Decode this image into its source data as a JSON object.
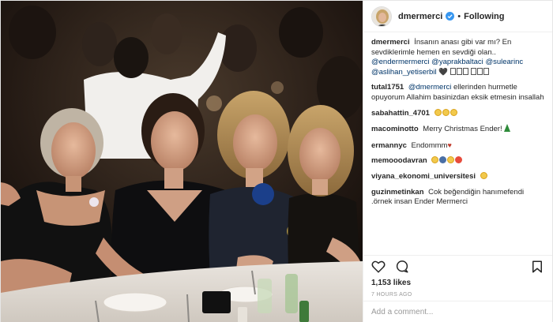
{
  "post": {
    "username": "dmermerci",
    "verified": true,
    "separator": "•",
    "follow_label": "Following",
    "likes": "1,153 likes",
    "time": "7 HOURS AGO",
    "comment_placeholder": "Add a comment..."
  },
  "caption": {
    "user": "dmermerci",
    "text": "İnsanın anası gibi var mı? En sevdiklerimle hemen en sevdiği olan..",
    "mentions": [
      "@endermermerci",
      "@yaprakbaltaci",
      "@sulearinc",
      "@aslihan_yetiserbil"
    ]
  },
  "comments": [
    {
      "user": "tutal1751",
      "mention": "@dmermerci",
      "text": "ellerinden hurmetle opuyorum Allahim basinizdan eksik etmesin insallah"
    },
    {
      "user": "sabahattin_4701",
      "text": "",
      "emoji": "clap-icons"
    },
    {
      "user": "macominotto",
      "text": "Merry Christmas Ender!",
      "emoji": "tree-icon"
    },
    {
      "user": "ermannyc",
      "text": "Endommm",
      "emoji": "heart-icon"
    },
    {
      "user": "memooodavran",
      "text": "",
      "emoji": "face-icons"
    },
    {
      "user": "viyana_ekonomi_universitesi",
      "text": "",
      "emoji": "thumb-icon"
    },
    {
      "user": "guzinmetinkan",
      "text": "Cok beğendiğin hanımefendi .örnek insan Ender Mermerci"
    }
  ],
  "colors": {
    "text": "#262626",
    "mention": "#003569",
    "verified": "#3897f0",
    "muted": "#999999"
  },
  "icons": [
    "verified-badge-icon",
    "heart-icon",
    "comment-icon",
    "bookmark-icon"
  ]
}
